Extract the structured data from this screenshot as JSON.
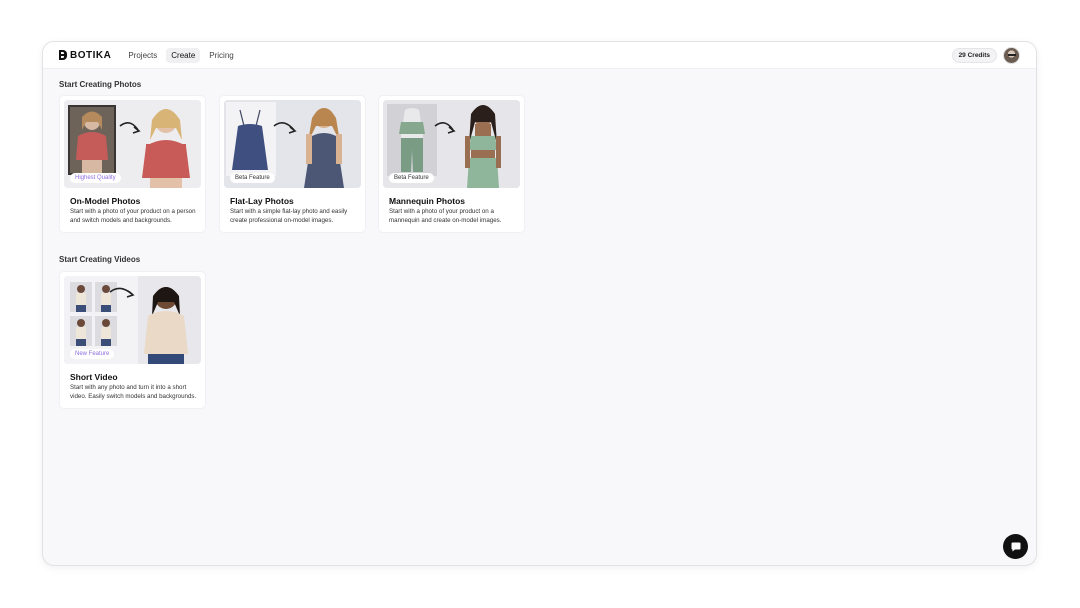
{
  "header": {
    "logo_text": "BOTIKA",
    "nav": [
      {
        "label": "Projects",
        "active": false
      },
      {
        "label": "Create",
        "active": true
      },
      {
        "label": "Pricing",
        "active": false
      }
    ],
    "credits": "29 Credits"
  },
  "photos_section": {
    "title": "Start Creating Photos",
    "cards": [
      {
        "title": "On-Model Photos",
        "badge": "Highest Quality",
        "desc": "Start with a photo of your product on a person and switch models and backgrounds."
      },
      {
        "title": "Flat-Lay Photos",
        "badge": "Beta Feature",
        "desc": "Start with a simple flat-lay photo and easily create professional on-model images."
      },
      {
        "title": "Mannequin Photos",
        "badge": "Beta Feature",
        "desc": "Start with a photo of your product on a mannequin and create on-model images."
      }
    ]
  },
  "videos_section": {
    "title": "Start Creating Videos",
    "cards": [
      {
        "title": "Short Video",
        "badge": "New Feature",
        "desc": "Start with any photo and turn it into a short video. Easily switch models and backgrounds."
      }
    ]
  },
  "colors": {
    "accent_purple": "#8e6ee0",
    "background": "#f8f8fa"
  }
}
